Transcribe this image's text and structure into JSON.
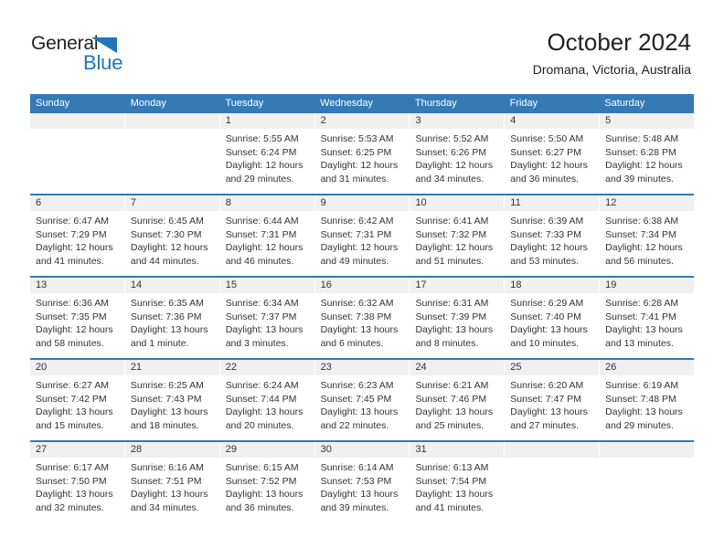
{
  "logo": {
    "word1": "General",
    "word2": "Blue",
    "triangle_color": "#1f74bd"
  },
  "header": {
    "title": "October 2024",
    "subtitle": "Dromana, Victoria, Australia"
  },
  "colors": {
    "header_blue": "#337ab7",
    "day_band_gray": "#f0f0f0",
    "text": "#333333"
  },
  "calendar": {
    "weekdays": [
      "Sunday",
      "Monday",
      "Tuesday",
      "Wednesday",
      "Thursday",
      "Friday",
      "Saturday"
    ],
    "weeks": [
      [
        {
          "day": "",
          "sunrise": "",
          "sunset": "",
          "daylight": ""
        },
        {
          "day": "",
          "sunrise": "",
          "sunset": "",
          "daylight": ""
        },
        {
          "day": "1",
          "sunrise": "Sunrise: 5:55 AM",
          "sunset": "Sunset: 6:24 PM",
          "daylight": "Daylight: 12 hours and 29 minutes."
        },
        {
          "day": "2",
          "sunrise": "Sunrise: 5:53 AM",
          "sunset": "Sunset: 6:25 PM",
          "daylight": "Daylight: 12 hours and 31 minutes."
        },
        {
          "day": "3",
          "sunrise": "Sunrise: 5:52 AM",
          "sunset": "Sunset: 6:26 PM",
          "daylight": "Daylight: 12 hours and 34 minutes."
        },
        {
          "day": "4",
          "sunrise": "Sunrise: 5:50 AM",
          "sunset": "Sunset: 6:27 PM",
          "daylight": "Daylight: 12 hours and 36 minutes."
        },
        {
          "day": "5",
          "sunrise": "Sunrise: 5:48 AM",
          "sunset": "Sunset: 6:28 PM",
          "daylight": "Daylight: 12 hours and 39 minutes."
        }
      ],
      [
        {
          "day": "6",
          "sunrise": "Sunrise: 6:47 AM",
          "sunset": "Sunset: 7:29 PM",
          "daylight": "Daylight: 12 hours and 41 minutes."
        },
        {
          "day": "7",
          "sunrise": "Sunrise: 6:45 AM",
          "sunset": "Sunset: 7:30 PM",
          "daylight": "Daylight: 12 hours and 44 minutes."
        },
        {
          "day": "8",
          "sunrise": "Sunrise: 6:44 AM",
          "sunset": "Sunset: 7:31 PM",
          "daylight": "Daylight: 12 hours and 46 minutes."
        },
        {
          "day": "9",
          "sunrise": "Sunrise: 6:42 AM",
          "sunset": "Sunset: 7:31 PM",
          "daylight": "Daylight: 12 hours and 49 minutes."
        },
        {
          "day": "10",
          "sunrise": "Sunrise: 6:41 AM",
          "sunset": "Sunset: 7:32 PM",
          "daylight": "Daylight: 12 hours and 51 minutes."
        },
        {
          "day": "11",
          "sunrise": "Sunrise: 6:39 AM",
          "sunset": "Sunset: 7:33 PM",
          "daylight": "Daylight: 12 hours and 53 minutes."
        },
        {
          "day": "12",
          "sunrise": "Sunrise: 6:38 AM",
          "sunset": "Sunset: 7:34 PM",
          "daylight": "Daylight: 12 hours and 56 minutes."
        }
      ],
      [
        {
          "day": "13",
          "sunrise": "Sunrise: 6:36 AM",
          "sunset": "Sunset: 7:35 PM",
          "daylight": "Daylight: 12 hours and 58 minutes."
        },
        {
          "day": "14",
          "sunrise": "Sunrise: 6:35 AM",
          "sunset": "Sunset: 7:36 PM",
          "daylight": "Daylight: 13 hours and 1 minute."
        },
        {
          "day": "15",
          "sunrise": "Sunrise: 6:34 AM",
          "sunset": "Sunset: 7:37 PM",
          "daylight": "Daylight: 13 hours and 3 minutes."
        },
        {
          "day": "16",
          "sunrise": "Sunrise: 6:32 AM",
          "sunset": "Sunset: 7:38 PM",
          "daylight": "Daylight: 13 hours and 6 minutes."
        },
        {
          "day": "17",
          "sunrise": "Sunrise: 6:31 AM",
          "sunset": "Sunset: 7:39 PM",
          "daylight": "Daylight: 13 hours and 8 minutes."
        },
        {
          "day": "18",
          "sunrise": "Sunrise: 6:29 AM",
          "sunset": "Sunset: 7:40 PM",
          "daylight": "Daylight: 13 hours and 10 minutes."
        },
        {
          "day": "19",
          "sunrise": "Sunrise: 6:28 AM",
          "sunset": "Sunset: 7:41 PM",
          "daylight": "Daylight: 13 hours and 13 minutes."
        }
      ],
      [
        {
          "day": "20",
          "sunrise": "Sunrise: 6:27 AM",
          "sunset": "Sunset: 7:42 PM",
          "daylight": "Daylight: 13 hours and 15 minutes."
        },
        {
          "day": "21",
          "sunrise": "Sunrise: 6:25 AM",
          "sunset": "Sunset: 7:43 PM",
          "daylight": "Daylight: 13 hours and 18 minutes."
        },
        {
          "day": "22",
          "sunrise": "Sunrise: 6:24 AM",
          "sunset": "Sunset: 7:44 PM",
          "daylight": "Daylight: 13 hours and 20 minutes."
        },
        {
          "day": "23",
          "sunrise": "Sunrise: 6:23 AM",
          "sunset": "Sunset: 7:45 PM",
          "daylight": "Daylight: 13 hours and 22 minutes."
        },
        {
          "day": "24",
          "sunrise": "Sunrise: 6:21 AM",
          "sunset": "Sunset: 7:46 PM",
          "daylight": "Daylight: 13 hours and 25 minutes."
        },
        {
          "day": "25",
          "sunrise": "Sunrise: 6:20 AM",
          "sunset": "Sunset: 7:47 PM",
          "daylight": "Daylight: 13 hours and 27 minutes."
        },
        {
          "day": "26",
          "sunrise": "Sunrise: 6:19 AM",
          "sunset": "Sunset: 7:48 PM",
          "daylight": "Daylight: 13 hours and 29 minutes."
        }
      ],
      [
        {
          "day": "27",
          "sunrise": "Sunrise: 6:17 AM",
          "sunset": "Sunset: 7:50 PM",
          "daylight": "Daylight: 13 hours and 32 minutes."
        },
        {
          "day": "28",
          "sunrise": "Sunrise: 6:16 AM",
          "sunset": "Sunset: 7:51 PM",
          "daylight": "Daylight: 13 hours and 34 minutes."
        },
        {
          "day": "29",
          "sunrise": "Sunrise: 6:15 AM",
          "sunset": "Sunset: 7:52 PM",
          "daylight": "Daylight: 13 hours and 36 minutes."
        },
        {
          "day": "30",
          "sunrise": "Sunrise: 6:14 AM",
          "sunset": "Sunset: 7:53 PM",
          "daylight": "Daylight: 13 hours and 39 minutes."
        },
        {
          "day": "31",
          "sunrise": "Sunrise: 6:13 AM",
          "sunset": "Sunset: 7:54 PM",
          "daylight": "Daylight: 13 hours and 41 minutes."
        },
        {
          "day": "",
          "sunrise": "",
          "sunset": "",
          "daylight": ""
        },
        {
          "day": "",
          "sunrise": "",
          "sunset": "",
          "daylight": ""
        }
      ]
    ]
  }
}
